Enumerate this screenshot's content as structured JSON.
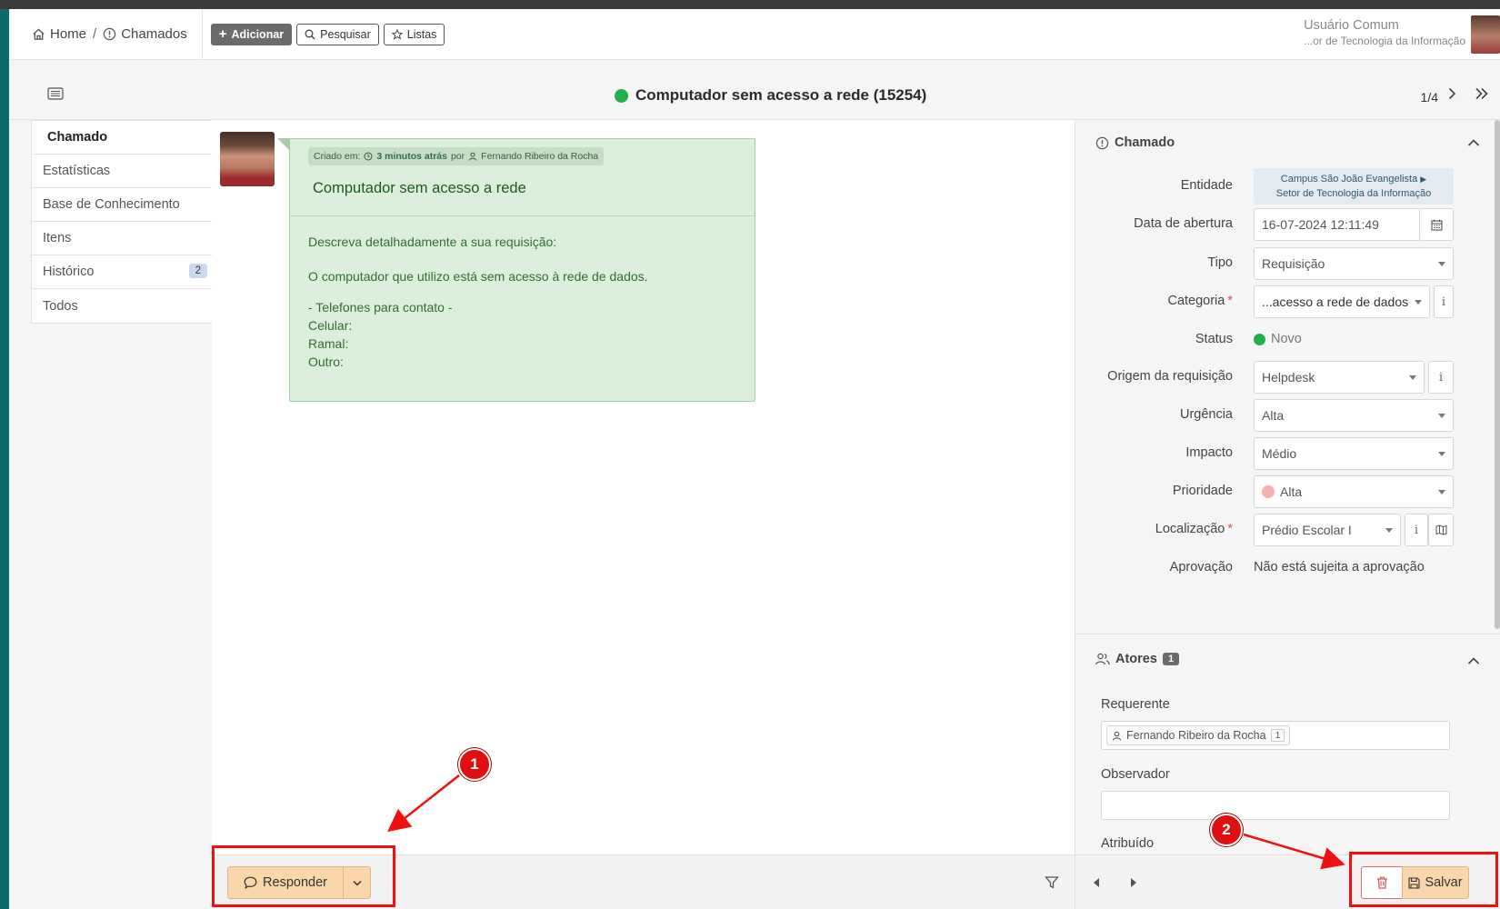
{
  "header": {
    "breadcrumb": [
      {
        "label": "Home",
        "icon": "home-icon"
      },
      {
        "label": "Chamados",
        "icon": "alert-circle-icon"
      }
    ],
    "add_label": "Adicionar",
    "search_label": "Pesquisar",
    "lists_label": "Listas",
    "user_name": "Usuário Comum",
    "user_entity": "...or de Tecnologia da Informação"
  },
  "titlebar": {
    "title": "Computador sem acesso a rede (15254)",
    "pager": "1/4"
  },
  "tabs": [
    {
      "label": "Chamado",
      "active": true
    },
    {
      "label": "Estatísticas"
    },
    {
      "label": "Base de Conhecimento"
    },
    {
      "label": "Itens"
    },
    {
      "label": "Histórico",
      "badge": "2"
    },
    {
      "label": "Todos"
    }
  ],
  "message": {
    "created_prefix": "Criado em:",
    "created_when": "3 minutos atrás",
    "by": "por",
    "author": "Fernando Ribeiro da Rocha",
    "title": "Computador sem acesso a rede",
    "lines": [
      "Descreva detalhadamente a sua requisição:",
      "O computador que utilizo está sem acesso à rede de dados.",
      "- Telefones para contato -",
      "Celular:",
      "Ramal:",
      "Outro:"
    ]
  },
  "footer": {
    "respond_label": "Responder",
    "save_label": "Salvar"
  },
  "panel": {
    "section_title": "Chamado",
    "fields": {
      "entidade": {
        "label": "Entidade",
        "line1": "Campus São João Evangelista",
        "line2": "Setor de Tecnologia da Informação"
      },
      "abertura": {
        "label": "Data de abertura",
        "value": "16-07-2024 12:11:49"
      },
      "tipo": {
        "label": "Tipo",
        "value": "Requisição"
      },
      "categoria": {
        "label": "Categoria",
        "value": "...acesso a rede de dados",
        "required": "*"
      },
      "status": {
        "label": "Status",
        "value": "Novo"
      },
      "origem": {
        "label": "Origem da requisição",
        "value": "Helpdesk"
      },
      "urgencia": {
        "label": "Urgência",
        "value": "Alta"
      },
      "impacto": {
        "label": "Impacto",
        "value": "Médio"
      },
      "prioridade": {
        "label": "Prioridade",
        "value": "Alta"
      },
      "localizacao": {
        "label": "Localização",
        "value": "Prédio Escolar I",
        "required": "*"
      },
      "aprovacao": {
        "label": "Aprovação",
        "value": "Não está sujeita a aprovação"
      }
    },
    "info_glyph": "i",
    "actors_title": "Atores",
    "actors_count": "1",
    "requerente_label": "Requerente",
    "requerente_name": "Fernando Ribeiro da Rocha",
    "requerente_count": "1",
    "observador_label": "Observador",
    "atribuido_label": "Atribuído"
  },
  "annotations": [
    "1",
    "2"
  ],
  "colors": {
    "accent_button": "#fbd6ab",
    "status_new": "#21b04b",
    "highlight": "#ee1111"
  }
}
